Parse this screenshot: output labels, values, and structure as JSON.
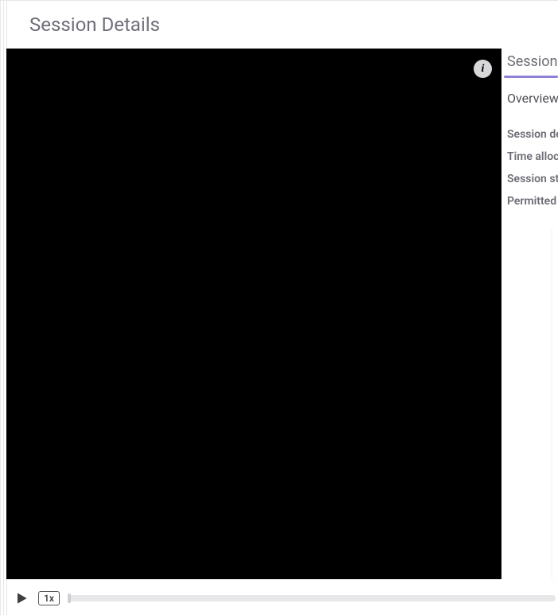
{
  "header": {
    "title": "Session Details"
  },
  "video": {
    "info_icon": "i"
  },
  "side": {
    "tab_label": "Session",
    "overview_label": "Overview",
    "meta": [
      "Session description or details",
      "Time allocated or allowed",
      "Session status or state",
      "Permitted actions or resources"
    ]
  },
  "player": {
    "speed_label": "1x",
    "progress_pct": 0
  }
}
